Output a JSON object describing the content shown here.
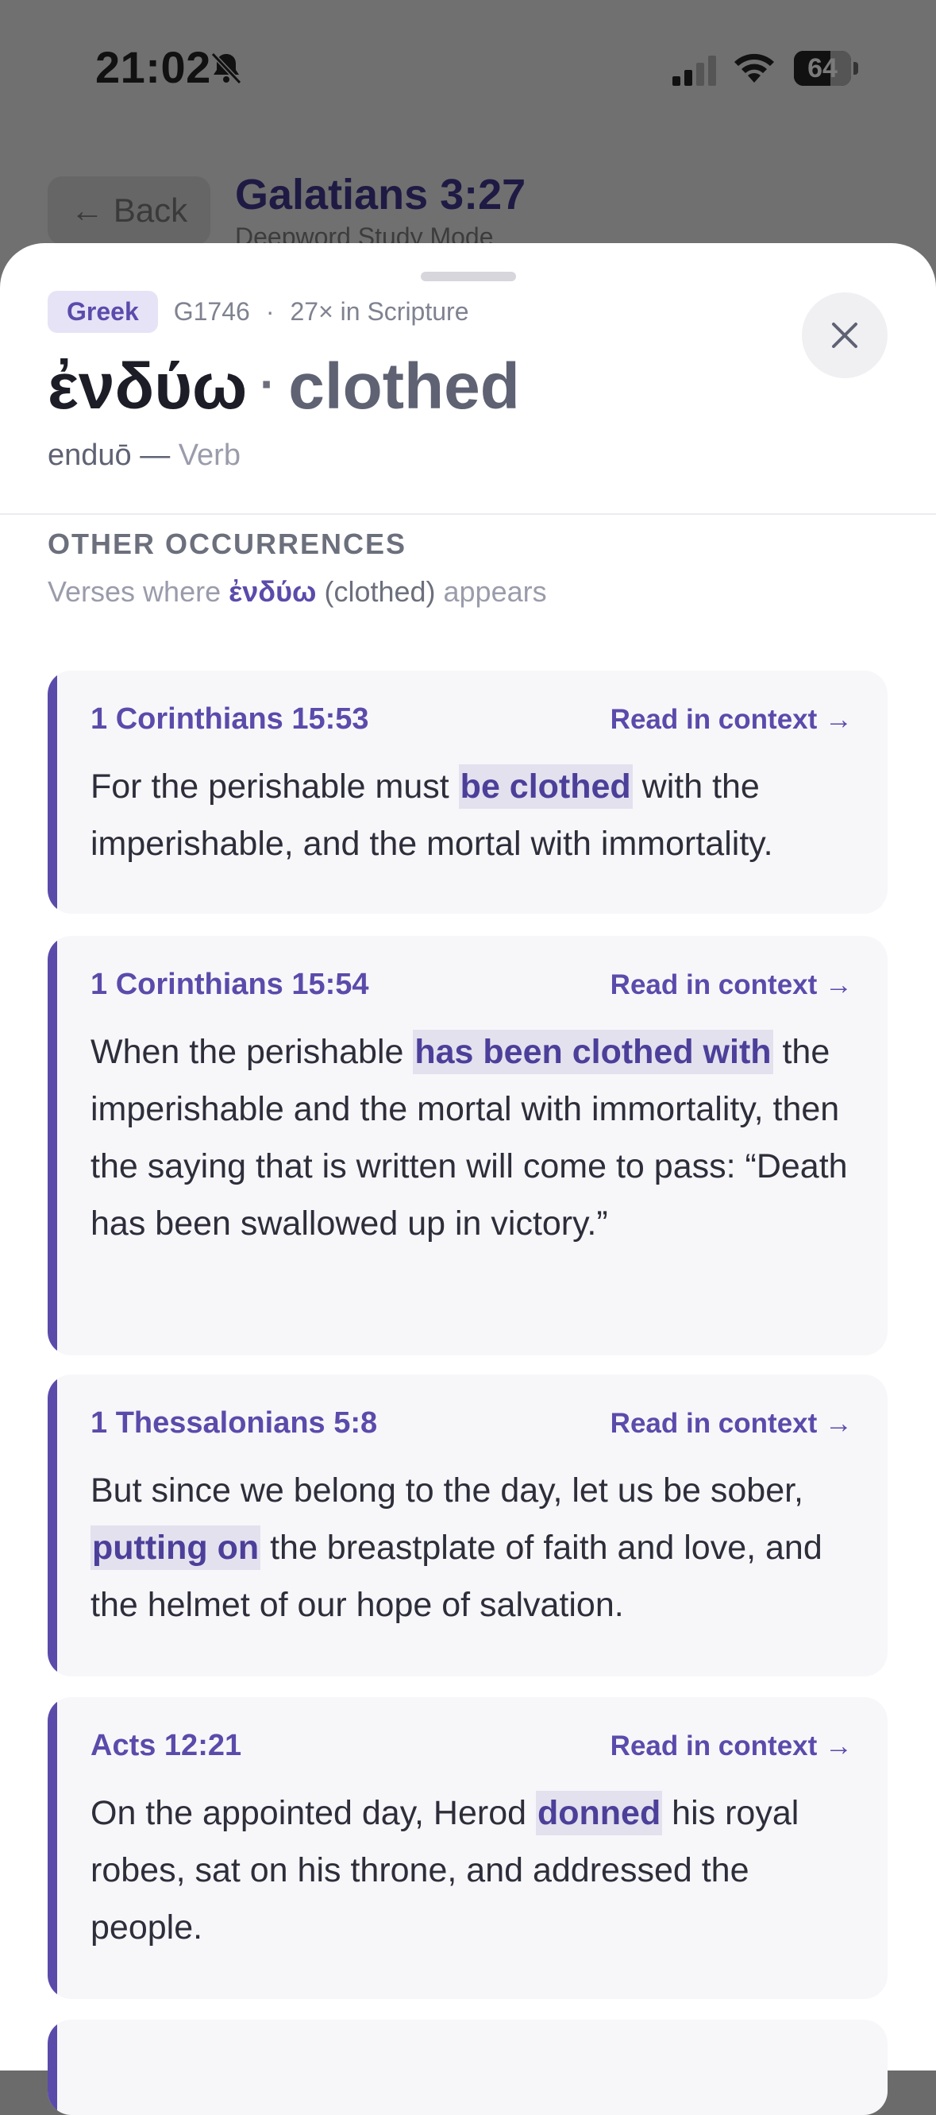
{
  "status_bar": {
    "time": "21:02",
    "battery": "64",
    "battery_level": 0.64
  },
  "background": {
    "back_label": "Back",
    "title": "Galatians 3:27",
    "subtitle": "Deepword Study Mode"
  },
  "sheet": {
    "language": "Greek",
    "strongs": "G1746",
    "separator": "·",
    "count": "27× in Scripture",
    "greek_word": "ἐνδύω",
    "headword_sep": "·",
    "gloss": "clothed",
    "transliteration": "enduō —",
    "part_of_speech": "Verb"
  },
  "occurrences": {
    "heading": "OTHER OCCURRENCES",
    "sub_before": "Verses where ",
    "sub_word": "ἐνδύω",
    "sub_paren": "(clothed)",
    "sub_after": " appears",
    "read_label": "Read in context →",
    "items": [
      {
        "ref": "1 Corinthians 15:53",
        "before": "For the perishable must ",
        "highlight": "be clothed",
        "after": " with the imperishable, and the mortal with immortality."
      },
      {
        "ref": "1 Corinthians 15:54",
        "before": "When the perishable ",
        "highlight": "has been clothed with",
        "after": " the imperishable and the mortal with immortality, then the saying that is written will come to pass: “Death has been swallowed up in victory.”"
      },
      {
        "ref": "1 Thessalonians 5:8",
        "before": "But since we belong to the day, let us be sober, ",
        "highlight": "putting on",
        "after": " the breastplate of faith and love, and the helmet of our hope of salvation."
      },
      {
        "ref": "Acts 12:21",
        "before": "On the appointed day, Herod ",
        "highlight": "donned",
        "after": " his royal robes, sat on his throne, and addressed the people."
      }
    ]
  },
  "colors": {
    "accent": "#5a4bab",
    "highlight_bg": "#e3e1ee",
    "card_bg": "#f7f7fa"
  }
}
